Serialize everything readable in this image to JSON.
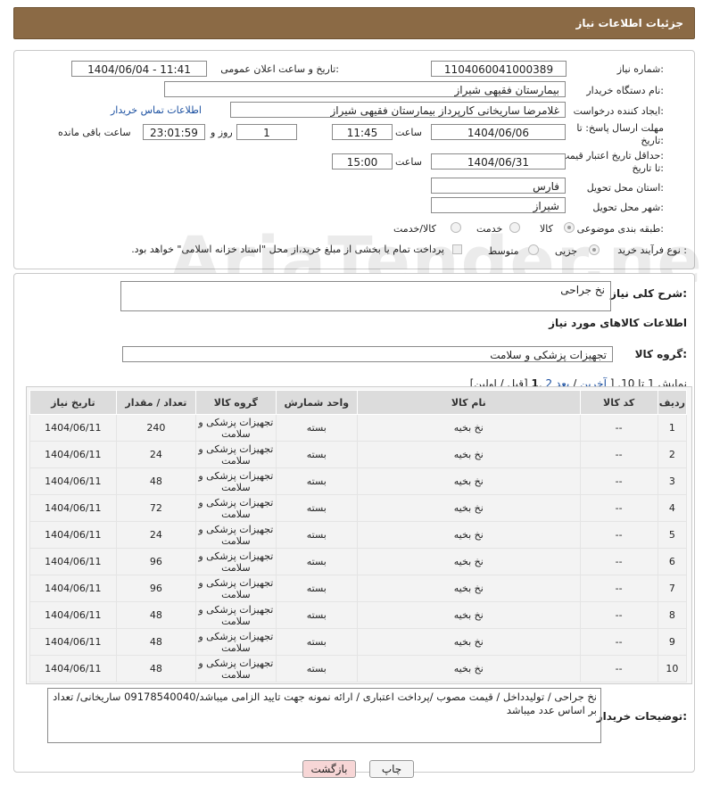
{
  "header": {
    "title": "جزئیات اطلاعات نیاز"
  },
  "form": {
    "need_number_label": "شماره نیاز:",
    "need_number": "1104060041000389",
    "announce_label": "تاریخ و ساعت اعلان عمومی:",
    "announce_value": "1404/06/04 - 11:41",
    "buyer_org_label": "نام دستگاه خریدار:",
    "buyer_org": "بیمارستان فقیهی شیراز",
    "creator_label": "ایجاد کننده درخواست:",
    "creator": "غلامرضا ساریخانی کارپرداز بیمارستان فقیهی شیراز",
    "contact_link": "اطلاعات تماس خریدار",
    "deadline_label_line1": "مهلت ارسال پاسخ: تا",
    "deadline_label_line2": "تاریخ:",
    "deadline_date": "1404/06/06",
    "time_label": "ساعت",
    "deadline_time": "11:45",
    "days_value": "1",
    "days_label": "روز و",
    "remaining_time": "23:01:59",
    "remaining_label": "ساعت باقی مانده",
    "validity_label_line1": "حداقل تاریخ اعتبار قیمت:",
    "validity_label_line2": "تا تاریخ:",
    "validity_date": "1404/06/31",
    "validity_time": "15:00",
    "province_label": "استان محل تحویل:",
    "province": "فارس",
    "city_label": "شهر محل تحویل:",
    "city": "شیراز",
    "category_label": "طبقه بندی موضوعی:",
    "category_options": [
      "کالا",
      "خدمت",
      "کالا/خدمت"
    ],
    "category_selected": "کالا",
    "process_label": "نوع فرآیند خرید :",
    "process_options": [
      "جزیی",
      "متوسط"
    ],
    "process_selected": "جزیی",
    "payment_note": "پرداخت تمام یا بخشی از مبلغ خرید،از محل \"اسناد خزانه اسلامی\" خواهد بود."
  },
  "details": {
    "general_desc_label": "شرح کلی نیاز:",
    "general_desc": "نخ جراحی",
    "goods_info_title": "اطلاعات کالاهای مورد نیاز",
    "goods_group_label": "گروه کالا:",
    "goods_group": "تجهیزات پزشکی و سلامت"
  },
  "pagination": {
    "prefix": "نمایش 1 تا 10. [",
    "last": "آخرین",
    "sep1": " / ",
    "next": "بعد",
    "page2": "2",
    "current": "1",
    "suffix": "[قبل / اولین]"
  },
  "table": {
    "headers": [
      "ردیف",
      "کد کالا",
      "نام کالا",
      "واحد شمارش",
      "گروه کالا",
      "تعداد / مقدار",
      "تاریخ نیاز"
    ],
    "rows": [
      [
        "1",
        "--",
        "نخ بخیه",
        "بسته",
        "تجهیزات پزشکی و سلامت",
        "240",
        "1404/06/11"
      ],
      [
        "2",
        "--",
        "نخ بخیه",
        "بسته",
        "تجهیزات پزشکی و سلامت",
        "24",
        "1404/06/11"
      ],
      [
        "3",
        "--",
        "نخ بخیه",
        "بسته",
        "تجهیزات پزشکی و سلامت",
        "48",
        "1404/06/11"
      ],
      [
        "4",
        "--",
        "نخ بخیه",
        "بسته",
        "تجهیزات پزشکی و سلامت",
        "72",
        "1404/06/11"
      ],
      [
        "5",
        "--",
        "نخ بخیه",
        "بسته",
        "تجهیزات پزشکی و سلامت",
        "24",
        "1404/06/11"
      ],
      [
        "6",
        "--",
        "نخ بخیه",
        "بسته",
        "تجهیزات پزشکی و سلامت",
        "96",
        "1404/06/11"
      ],
      [
        "7",
        "--",
        "نخ بخیه",
        "بسته",
        "تجهیزات پزشکی و سلامت",
        "96",
        "1404/06/11"
      ],
      [
        "8",
        "--",
        "نخ بخیه",
        "بسته",
        "تجهیزات پزشکی و سلامت",
        "48",
        "1404/06/11"
      ],
      [
        "9",
        "--",
        "نخ بخیه",
        "بسته",
        "تجهیزات پزشکی و سلامت",
        "48",
        "1404/06/11"
      ],
      [
        "10",
        "--",
        "نخ بخیه",
        "بسته",
        "تجهیزات پزشکی و سلامت",
        "48",
        "1404/06/11"
      ]
    ]
  },
  "buyer_notes": {
    "label": "توضیحات خریدار:",
    "text": "نخ جراحی / تولیدداخل / قیمت مصوب /پرداخت اعتباری / ارائه نمونه جهت تایید الزامی میباشد/09178540040 ساریخانی/ تعداد بر اساس عدد میباشد"
  },
  "buttons": {
    "print": "چاپ",
    "back": "بازگشت"
  },
  "watermark": "AriaTender.neT",
  "colors": {
    "header_bg": "#8b6a45",
    "back_button_bg": "#f7d6d6",
    "link": "#1a4fa0"
  }
}
